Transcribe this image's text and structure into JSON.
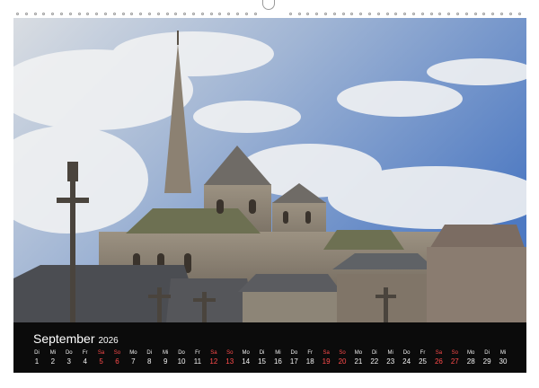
{
  "calendar": {
    "month": "September",
    "year": "2026",
    "days": [
      {
        "n": "1",
        "d": "Di"
      },
      {
        "n": "2",
        "d": "Mi"
      },
      {
        "n": "3",
        "d": "Do"
      },
      {
        "n": "4",
        "d": "Fr"
      },
      {
        "n": "5",
        "d": "Sa",
        "we": true
      },
      {
        "n": "6",
        "d": "So",
        "we": true
      },
      {
        "n": "7",
        "d": "Mo"
      },
      {
        "n": "8",
        "d": "Di"
      },
      {
        "n": "9",
        "d": "Mi"
      },
      {
        "n": "10",
        "d": "Do"
      },
      {
        "n": "11",
        "d": "Fr"
      },
      {
        "n": "12",
        "d": "Sa",
        "we": true
      },
      {
        "n": "13",
        "d": "So",
        "we": true
      },
      {
        "n": "14",
        "d": "Mo"
      },
      {
        "n": "15",
        "d": "Di"
      },
      {
        "n": "16",
        "d": "Mi"
      },
      {
        "n": "17",
        "d": "Do"
      },
      {
        "n": "18",
        "d": "Fr"
      },
      {
        "n": "19",
        "d": "Sa",
        "we": true
      },
      {
        "n": "20",
        "d": "So",
        "we": true
      },
      {
        "n": "21",
        "d": "Mo"
      },
      {
        "n": "22",
        "d": "Di"
      },
      {
        "n": "23",
        "d": "Mi"
      },
      {
        "n": "24",
        "d": "Do"
      },
      {
        "n": "25",
        "d": "Fr"
      },
      {
        "n": "26",
        "d": "Sa",
        "we": true
      },
      {
        "n": "27",
        "d": "So",
        "we": true
      },
      {
        "n": "28",
        "d": "Mo"
      },
      {
        "n": "29",
        "d": "Di"
      },
      {
        "n": "30",
        "d": "Mi"
      }
    ]
  },
  "colors": {
    "weekend": "#ff4b4b",
    "bar": "#0b0b0b",
    "sky": "#5d86c9",
    "stone": "#8b8070"
  }
}
